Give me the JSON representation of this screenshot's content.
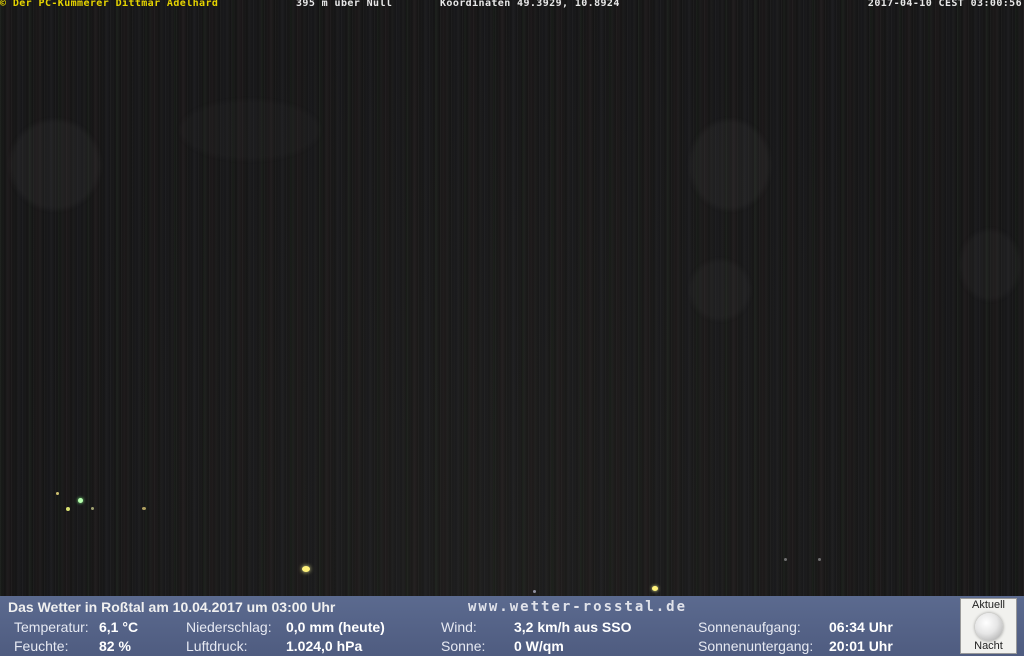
{
  "overlay": {
    "copyright": "© Der PC-Kümmerer Dittmar Adelhard",
    "altitude": "395 m über Null",
    "coordinates": "Koordinaten 49.3929, 10.8924",
    "datetime": "2017-04-10 CEST 03:00:56"
  },
  "weather": {
    "title": "Das Wetter in Roßtal am 10.04.2017 um 03:00 Uhr",
    "website": "www.wetter-rosstal.de",
    "temperature": {
      "label": "Temperatur:",
      "value": "6,1 °C"
    },
    "humidity": {
      "label": "Feuchte:",
      "value": "82 %"
    },
    "precipitation": {
      "label": "Niederschlag:",
      "value": "0,0 mm (heute)"
    },
    "pressure": {
      "label": "Luftdruck:",
      "value": "1.024,0 hPa"
    },
    "wind": {
      "label": "Wind:",
      "value": "3,2 km/h aus SSO"
    },
    "sun": {
      "label": "Sonne:",
      "value": "0 W/qm"
    },
    "sunrise": {
      "label": "Sonnenaufgang:",
      "value": "06:34 Uhr"
    },
    "sunset": {
      "label": "Sonnenuntergang:",
      "value": "20:01 Uhr"
    }
  },
  "moon": {
    "label_top": "Aktuell",
    "label_bottom": "Nacht",
    "icon": "full-moon-icon"
  }
}
